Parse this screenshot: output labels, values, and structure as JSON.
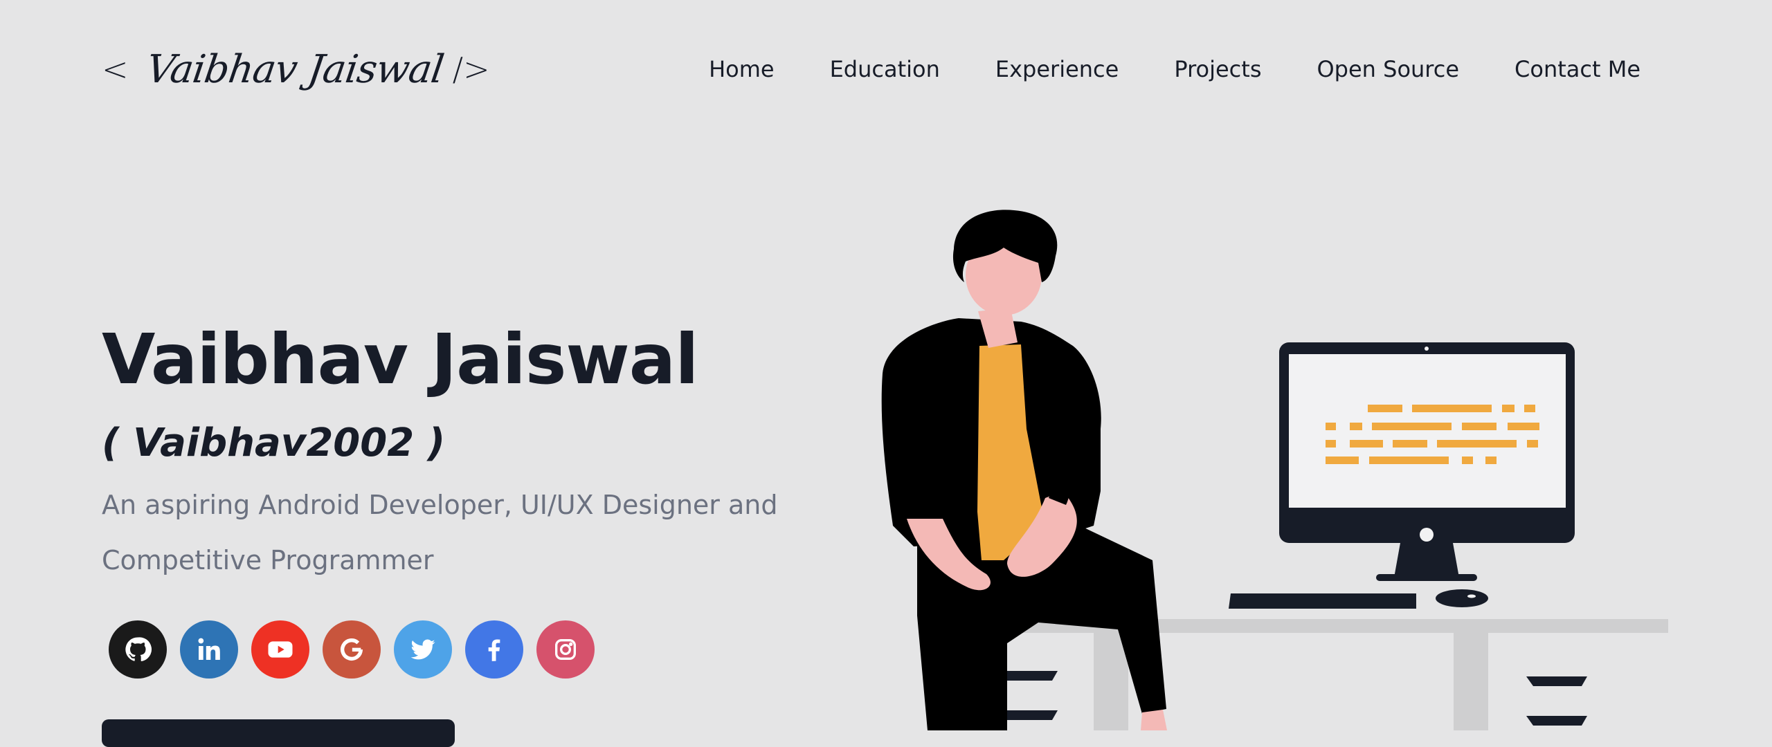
{
  "header": {
    "logo": {
      "open": "<",
      "name": "Vaibhav Jaiswal",
      "close": "/>"
    },
    "nav": [
      {
        "label": "Home"
      },
      {
        "label": "Education"
      },
      {
        "label": "Experience"
      },
      {
        "label": "Projects"
      },
      {
        "label": "Open Source"
      },
      {
        "label": "Contact Me"
      }
    ]
  },
  "hero": {
    "title": "Vaibhav Jaiswal",
    "handle": "( Vaibhav2002 )",
    "subtitle": "An aspiring Android Developer, UI/UX Designer and Competitive Programmer"
  },
  "social": [
    {
      "icon": "github-icon",
      "color": "#1a1a1a"
    },
    {
      "icon": "linkedin-icon",
      "color": "#2e74b5"
    },
    {
      "icon": "youtube-icon",
      "color": "#ee3124"
    },
    {
      "icon": "google-icon",
      "color": "#c8553d"
    },
    {
      "icon": "twitter-icon",
      "color": "#4ea3e8"
    },
    {
      "icon": "facebook-icon",
      "color": "#4277e6"
    },
    {
      "icon": "instagram-icon",
      "color": "#d6526c"
    }
  ],
  "colors": {
    "background": "#e5e5e6",
    "primary": "#171c28",
    "subtitle": "#6b7180",
    "accent": "#f0a93f",
    "skin": "#f4b9b6"
  }
}
